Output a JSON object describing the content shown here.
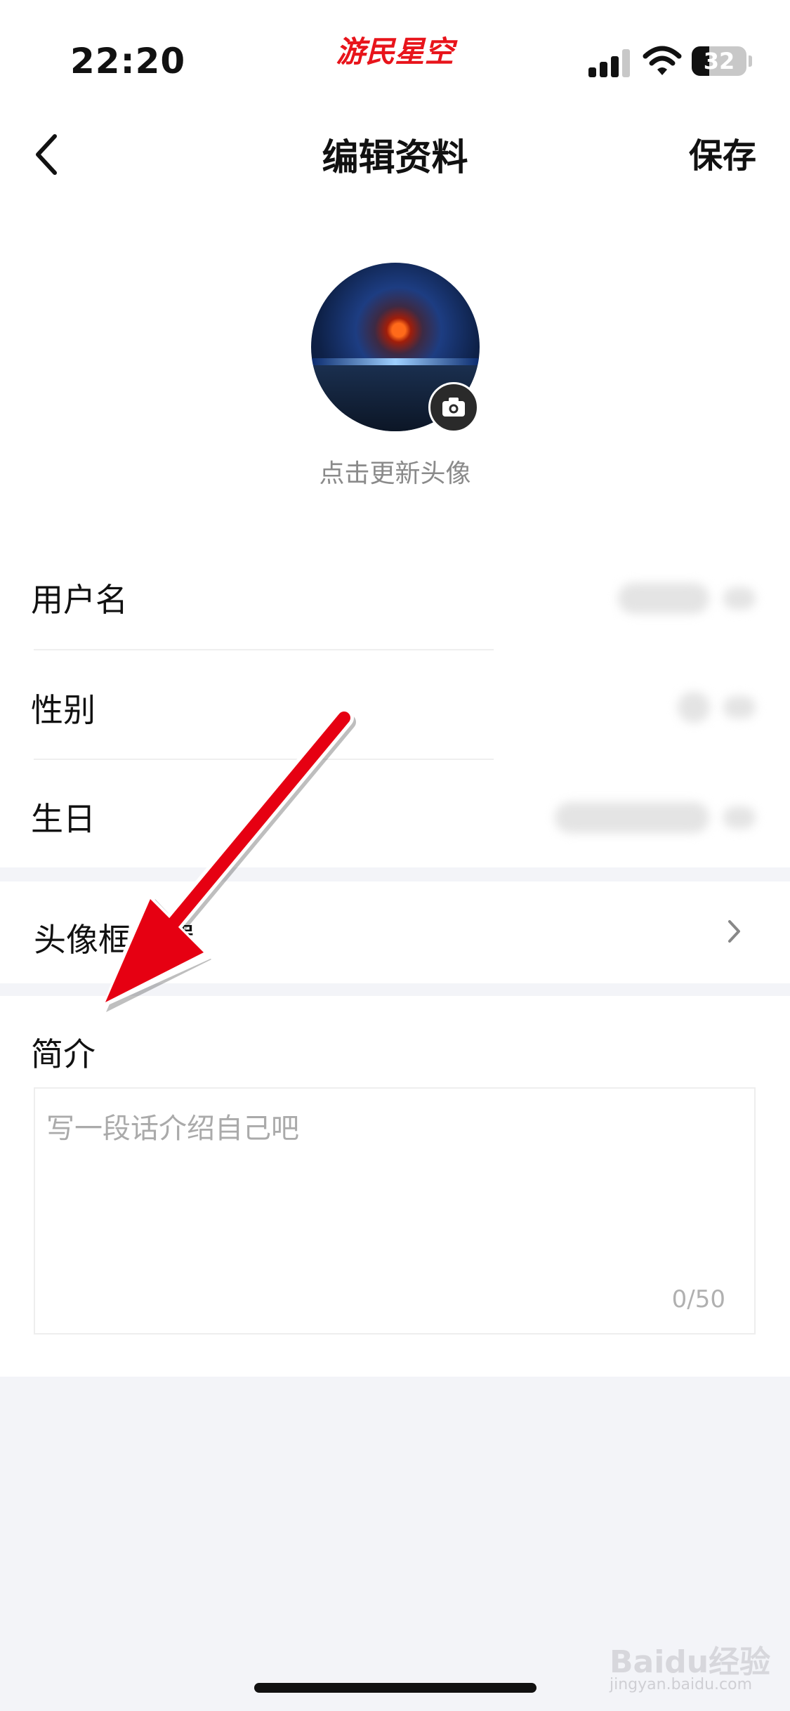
{
  "status_bar": {
    "time": "22:20",
    "brand": "游民星空",
    "battery": "32",
    "signal_icon": "cellular-signal-icon",
    "wifi_icon": "wifi-icon"
  },
  "nav": {
    "title": "编辑资料",
    "save_label": "保存",
    "back_icon": "chevron-left-icon"
  },
  "avatar": {
    "caption": "点击更新头像",
    "camera_icon": "camera-icon"
  },
  "profile_rows": [
    {
      "label": "用户名"
    },
    {
      "label": "性别"
    },
    {
      "label": "生日"
    }
  ],
  "frame_row": {
    "label": "头像框设置",
    "icon": "chevron-right-icon"
  },
  "intro": {
    "title": "简介",
    "placeholder": "写一段话介绍自己吧",
    "counter": "0/50"
  },
  "watermark": {
    "text": "Baidu经验",
    "sub": "jingyan.baidu.com"
  },
  "colors": {
    "brand": "#e8141b",
    "arrow": "#e60012",
    "page_bg": "#f3f4f8"
  }
}
